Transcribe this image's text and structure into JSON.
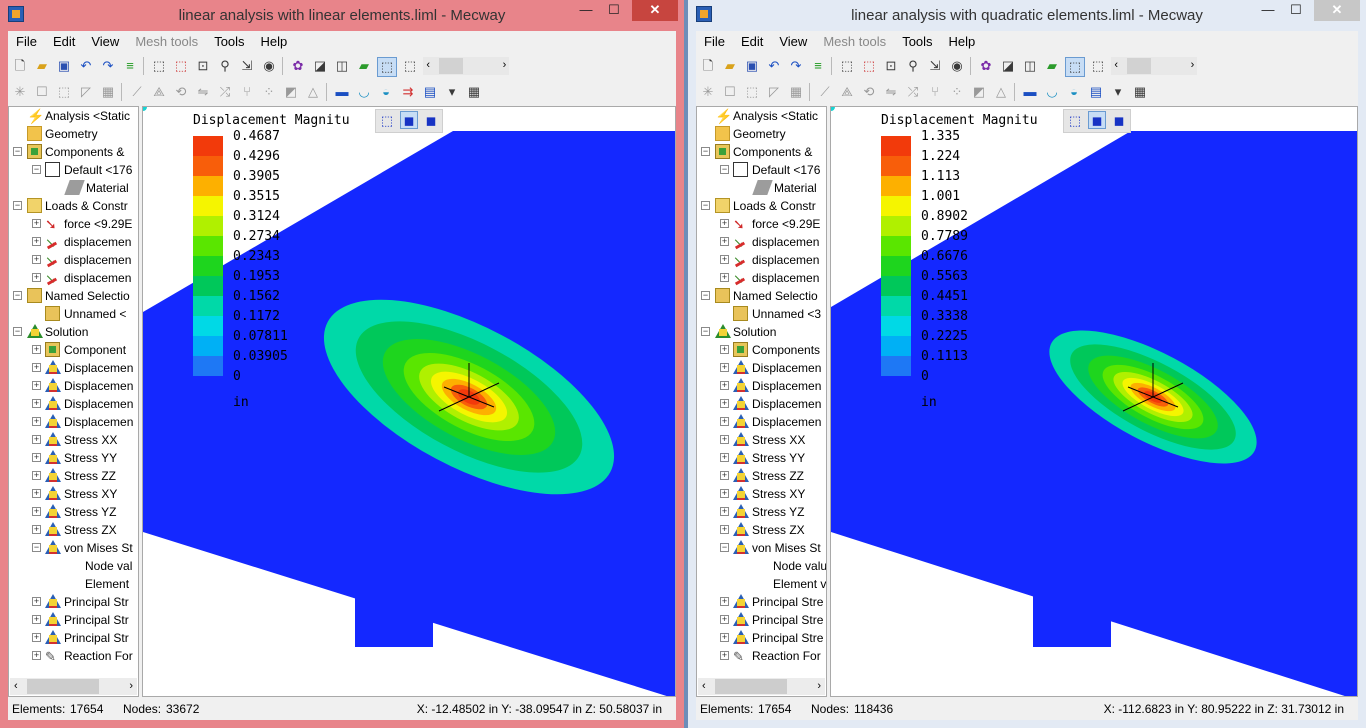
{
  "menus": [
    "File",
    "Edit",
    "View",
    "Mesh tools",
    "Tools",
    "Help"
  ],
  "menus_disabled": [
    "Mesh tools"
  ],
  "left_window": {
    "title": "linear analysis with linear elements.liml - Mecway",
    "tree": {
      "analysis": "Analysis <Static",
      "geometry": "Geometry",
      "components": "Components &",
      "default": "Default <176",
      "material": "Material",
      "loads": "Loads & Constr",
      "force": "force <9.29E",
      "disp1": "displacemen",
      "disp2": "displacemen",
      "disp3": "displacemen",
      "named": "Named Selectio",
      "unnamed": "Unnamed <",
      "solution": "Solution",
      "components_sol": "Component",
      "dispA": "Displacemen",
      "dispB": "Displacemen",
      "dispC": "Displacemen",
      "dispD": "Displacemen",
      "sxx": "Stress XX",
      "syy": "Stress YY",
      "szz": "Stress ZZ",
      "sxy": "Stress XY",
      "syz": "Stress YZ",
      "szx": "Stress ZX",
      "vonmises": "von Mises St",
      "nodeval": "Node val",
      "element": "Element",
      "p1": "Principal Str",
      "p2": "Principal Str",
      "p3": "Principal Str",
      "reaction": "Reaction For"
    },
    "legend": {
      "title": "Displacement Magnitu",
      "values": [
        "0.4687",
        "0.4296",
        "0.3905",
        "0.3515",
        "0.3124",
        "0.2734",
        "0.2343",
        "0.1953",
        "0.1562",
        "0.1172",
        "0.07811",
        "0.03905",
        "0"
      ],
      "unit": "in"
    },
    "status": {
      "elements_label": "Elements:",
      "elements": "17654",
      "nodes_label": "Nodes:",
      "nodes": "33672",
      "coords": "X: -12.48502 in Y: -38.09547 in Z: 50.58037 in"
    }
  },
  "right_window": {
    "title": "linear analysis with quadratic elements.liml - Mecway",
    "tree": {
      "analysis": "Analysis <Static",
      "geometry": "Geometry",
      "components": "Components &",
      "default": "Default <176",
      "material": "Material",
      "loads": "Loads & Constr",
      "force": "force <9.29E",
      "disp1": "displacemen",
      "disp2": "displacemen",
      "disp3": "displacemen",
      "named": "Named Selectio",
      "unnamed": "Unnamed <3",
      "solution": "Solution",
      "components_sol": "Components",
      "dispA": "Displacemen",
      "dispB": "Displacemen",
      "dispC": "Displacemen",
      "dispD": "Displacemen",
      "sxx": "Stress XX",
      "syy": "Stress YY",
      "szz": "Stress ZZ",
      "sxy": "Stress XY",
      "syz": "Stress YZ",
      "szx": "Stress ZX",
      "vonmises": "von Mises St",
      "nodeval": "Node valu",
      "element": "Element v",
      "p1": "Principal Stre",
      "p2": "Principal Stre",
      "p3": "Principal Stre",
      "reaction": "Reaction For"
    },
    "legend": {
      "title": "Displacement Magnitu",
      "values": [
        "1.335",
        "1.224",
        "1.113",
        "1.001",
        "0.8902",
        "0.7789",
        "0.6676",
        "0.5563",
        "0.4451",
        "0.3338",
        "0.2225",
        "0.1113",
        "0"
      ],
      "unit": "in"
    },
    "status": {
      "elements_label": "Elements:",
      "elements": "17654",
      "nodes_label": "Nodes:",
      "nodes": "118436",
      "coords": "X: -112.6823 in Y: 80.95222 in Z: 31.73012 in"
    }
  },
  "colors": {
    "legend_scale": [
      "#f23a0b",
      "#f85e0a",
      "#fdb000",
      "#f5f500",
      "#b0f000",
      "#5ae600",
      "#1ed51e",
      "#00c85a",
      "#00d9a8",
      "#00d9e6",
      "#00b0f5",
      "#1e78f5"
    ],
    "plate": "#1428ff",
    "axis_x": "#e8141e",
    "axis_y": "#14c814",
    "axis_z": "#1428e8"
  },
  "axes": {
    "x": "X",
    "y": "Y",
    "z": "Z"
  }
}
